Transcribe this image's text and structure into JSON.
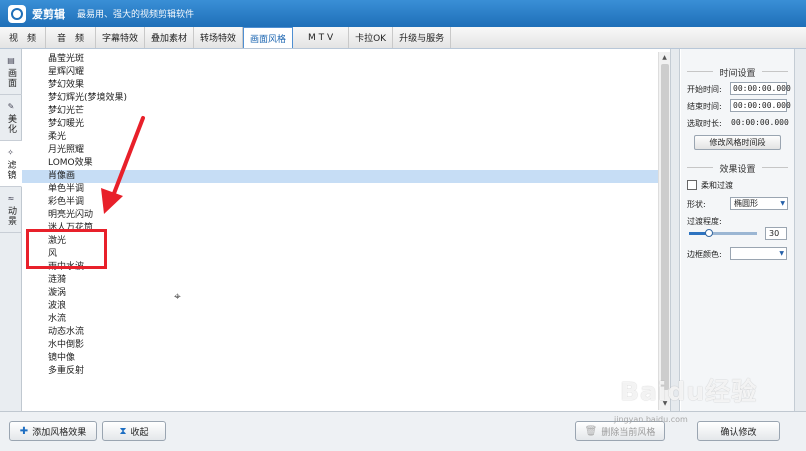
{
  "app": {
    "name": "爱剪辑",
    "slogan": "最易用、强大的视频剪辑软件"
  },
  "menu": {
    "tabs": [
      "视　频",
      "音　频",
      "字幕特效",
      "叠加素材",
      "转场特效",
      "画面风格",
      "M T V",
      "卡拉OK",
      "升级与服务"
    ],
    "active": "画面风格"
  },
  "side_tabs": [
    {
      "label": "画面",
      "icon": "screen-icon"
    },
    {
      "label": "美化",
      "icon": "magic-wand-icon"
    },
    {
      "label": "滤镜",
      "icon": "filter-wand-icon"
    },
    {
      "label": "动景",
      "icon": "wave-icon"
    }
  ],
  "side_active": "滤镜",
  "list": {
    "items": [
      "晶莹光斑",
      "星辉闪耀",
      "梦幻效果",
      "梦幻辉光(梦境效果)",
      "梦幻光芒",
      "梦幻暖光",
      "柔光",
      "月光照耀",
      "LOMO效果",
      "肖像画",
      "单色半调",
      "彩色半调",
      "明亮光闪动",
      "迷人万花筒",
      "激光",
      "风",
      "雨中水波",
      "涟漪",
      "漩涡",
      "波浪",
      "水流",
      "动态水流",
      "水中倒影",
      "镜中像",
      "多重反射"
    ],
    "selected": "肖像画"
  },
  "settings": {
    "time_section": "时间设置",
    "start_label": "开始时间:",
    "start_value": "00:00:00.000",
    "end_label": "结束时间:",
    "end_value": "00:00:00.000",
    "duration_label": "选取时长:",
    "duration_value": "00:00:00.000",
    "modify_button": "修改风格时间段",
    "effect_section": "效果设置",
    "soft_transition_label": "柔和过渡",
    "shape_label": "形状:",
    "shape_value": "椭圆形",
    "transition_label": "过渡程度:",
    "transition_value": "30",
    "transition_fraction": 0.3,
    "border_color_label": "边框颜色:"
  },
  "bottom": {
    "add_effect": "添加风格效果",
    "collapse": "收起",
    "delete_effect": "删除当前风格",
    "confirm": "确认修改"
  },
  "watermark": {
    "main": "Baidu经验",
    "sub": "jingyan.baidu.com"
  },
  "colors": {
    "title_bar": "#1f6fb8",
    "selection": "#c6ddf5",
    "annotation": "#e8202a"
  }
}
